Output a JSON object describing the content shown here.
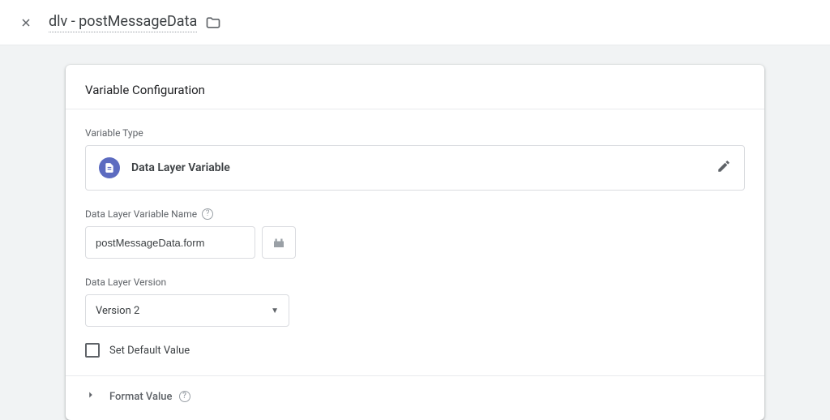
{
  "page": {
    "title": "dlv - postMessageData"
  },
  "card": {
    "header": "Variable Configuration",
    "labels": {
      "variable_type": "Variable Type",
      "name": "Data Layer Variable Name",
      "version": "Data Layer Version",
      "set_default": "Set Default Value",
      "format_value": "Format Value"
    },
    "variable_type": {
      "name": "Data Layer Variable"
    },
    "name_value": "postMessageData.form",
    "version_value": "Version 2"
  }
}
